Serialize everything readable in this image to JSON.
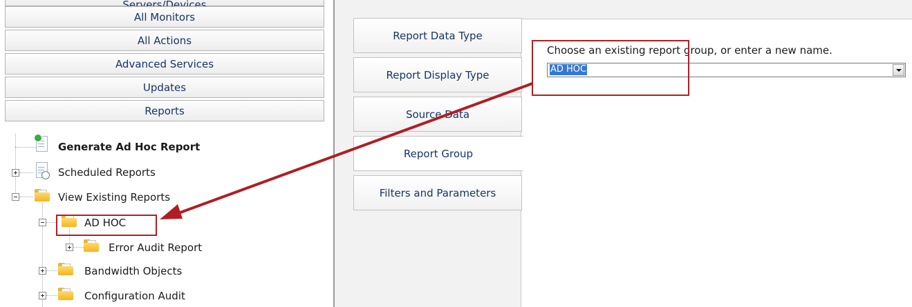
{
  "nav": {
    "buttons": [
      {
        "label": "Servers/Devices"
      },
      {
        "label": "All Monitors"
      },
      {
        "label": "All Actions"
      },
      {
        "label": "Advanced Services"
      },
      {
        "label": "Updates"
      },
      {
        "label": "Reports"
      }
    ]
  },
  "tree": {
    "generate": "Generate Ad Hoc Report",
    "scheduled": "Scheduled Reports",
    "view_existing": "View Existing Reports",
    "ad_hoc": "AD HOC",
    "error_audit": "Error Audit Report",
    "bandwidth": "Bandwidth Objects",
    "config_audit": "Configuration Audit"
  },
  "tabs": [
    {
      "label": "Report Data Type"
    },
    {
      "label": "Report Display Type"
    },
    {
      "label": "Source Data"
    },
    {
      "label": "Report Group"
    },
    {
      "label": "Filters and Parameters"
    }
  ],
  "report_group": {
    "prompt": "Choose an existing report group, or enter a new name.",
    "value": "AD HOC"
  },
  "colors": {
    "highlight_box": "#b01e23",
    "nav_text": "#15356a",
    "selection": "#3478d6"
  }
}
